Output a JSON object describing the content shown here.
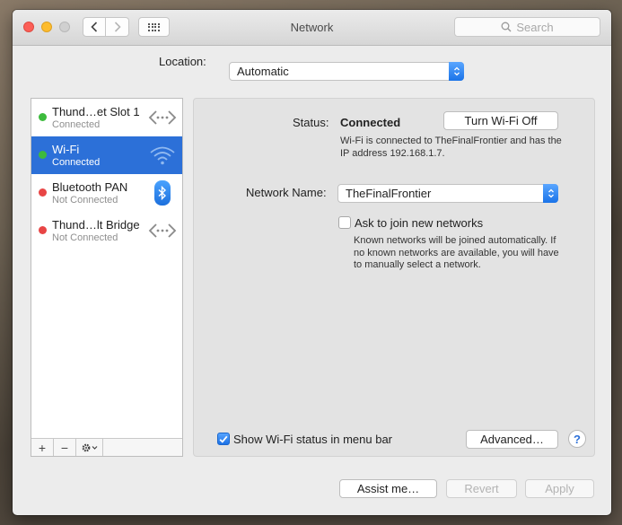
{
  "window": {
    "title": "Network"
  },
  "toolbar": {
    "search_placeholder": "Search"
  },
  "location": {
    "label": "Location:",
    "value": "Automatic"
  },
  "services": [
    {
      "name": "Thund…et Slot 1",
      "status": "Connected",
      "status_color": "#3dbb3d",
      "icon": "ethernet-icon"
    },
    {
      "name": "Wi-Fi",
      "status": "Connected",
      "status_color": "#3dbb3d",
      "icon": "wifi-icon"
    },
    {
      "name": "Bluetooth PAN",
      "status": "Not Connected",
      "status_color": "#e84545",
      "icon": "bluetooth-icon"
    },
    {
      "name": "Thund…lt Bridge",
      "status": "Not Connected",
      "status_color": "#e84545",
      "icon": "ethernet-icon"
    }
  ],
  "selected_service": "Wi-Fi",
  "sidebar_controls": {
    "add": "+",
    "remove": "−"
  },
  "detail": {
    "status_label": "Status:",
    "status_value": "Connected",
    "turn_off_button": "Turn Wi-Fi Off",
    "status_description": "Wi-Fi is connected to TheFinalFrontier and has the IP address 192.168.1.7.",
    "network_name_label": "Network Name:",
    "network_name_value": "TheFinalFrontier",
    "ask_join_label": "Ask to join new networks",
    "ask_join_checked": false,
    "ask_join_description": "Known networks will be joined automatically. If no known networks are available, you will have to manually select a network.",
    "show_status_label": "Show Wi-Fi status in menu bar",
    "show_status_checked": true,
    "advanced_button": "Advanced…",
    "help_button": "?"
  },
  "footer": {
    "assist_button": "Assist me…",
    "revert_button": "Revert",
    "apply_button": "Apply"
  },
  "colors": {
    "selection": "#2c70d8",
    "accent": "#1c72e6"
  }
}
